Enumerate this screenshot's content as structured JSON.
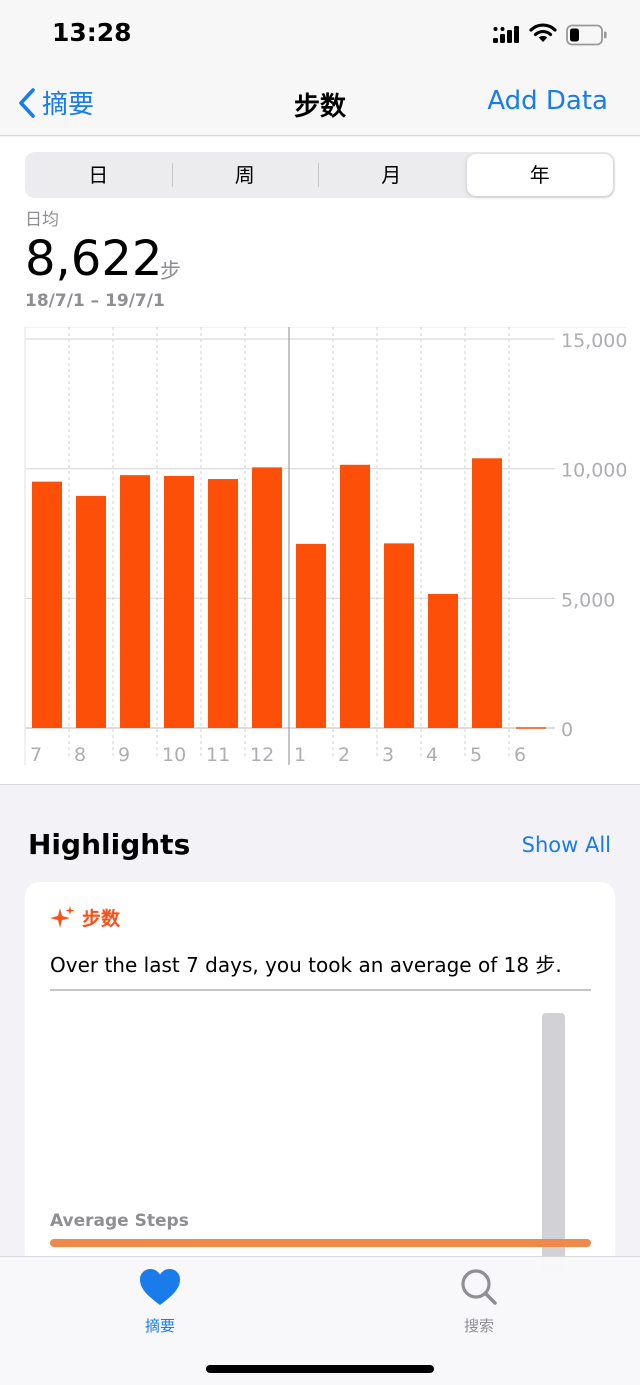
{
  "status": {
    "time": "13:28"
  },
  "nav": {
    "back_label": "摘要",
    "title": "步数",
    "add_label": "Add Data"
  },
  "segments": [
    {
      "label": "日",
      "active": false
    },
    {
      "label": "周",
      "active": false
    },
    {
      "label": "月",
      "active": false
    },
    {
      "label": "年",
      "active": true
    }
  ],
  "summary": {
    "label": "日均",
    "value": "8,622",
    "unit": "步",
    "range": "18/7/1 – 19/7/1"
  },
  "chart_data": {
    "type": "bar",
    "categories": [
      "7",
      "8",
      "9",
      "10",
      "11",
      "12",
      "1",
      "2",
      "3",
      "4",
      "5",
      "6"
    ],
    "values": [
      9500,
      8950,
      9750,
      9720,
      9600,
      10050,
      7100,
      10150,
      7120,
      5170,
      10400,
      0
    ],
    "yticks": [
      "15,000",
      "10,000",
      "5,000",
      "0"
    ],
    "ylim": [
      0,
      15000
    ],
    "grid": true,
    "bar_color": "#fe4f09"
  },
  "highlights": {
    "title": "Highlights",
    "show_all": "Show All",
    "card_title": "步数",
    "card_text": "Over the last 7 days, you took an average of 18 步.",
    "avg_label": "Average Steps"
  },
  "tabs": {
    "summary": "摘要",
    "search": "搜索"
  },
  "colors": {
    "accent": "#1a7cea",
    "bar": "#fe4f09",
    "highlight": "#fa5018"
  }
}
